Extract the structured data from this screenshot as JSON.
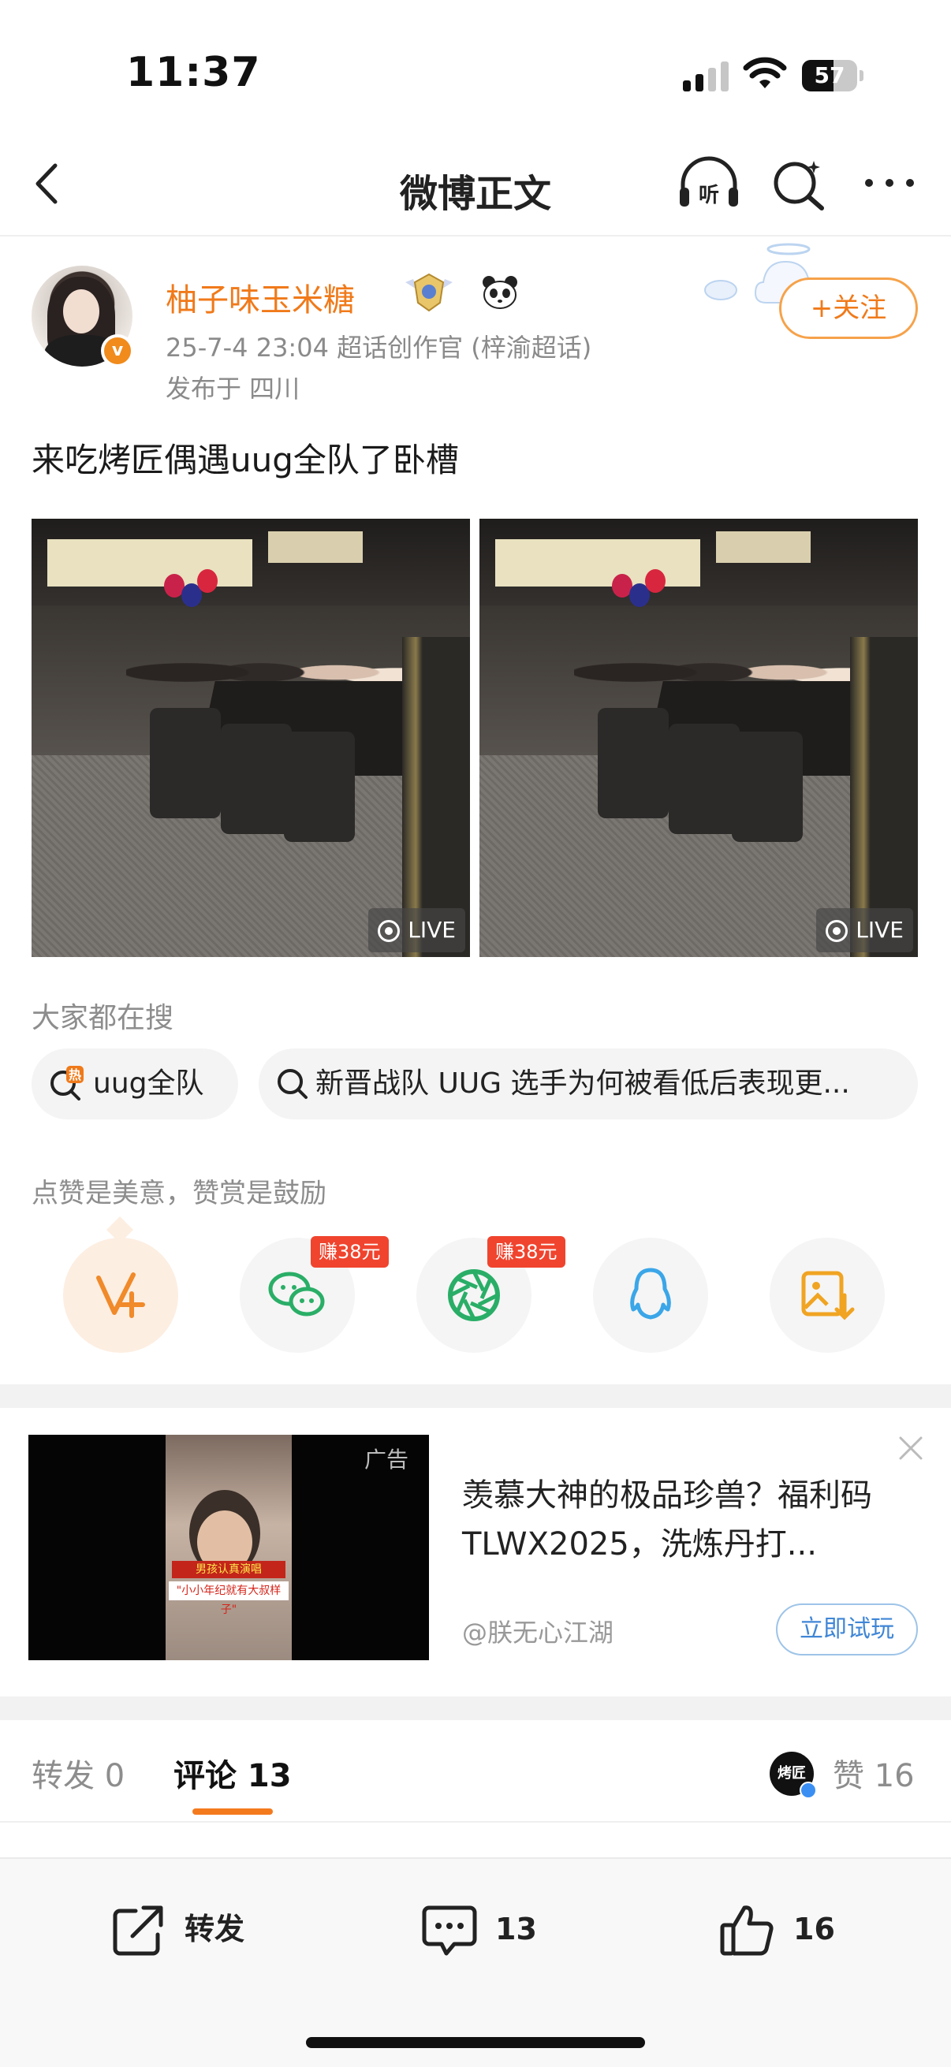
{
  "status_bar": {
    "time": "11:37",
    "battery": "57",
    "battery_level": 0.57
  },
  "nav": {
    "title": "微博正文",
    "listen_icon_text": "听"
  },
  "post": {
    "username": "柚子味玉米糖",
    "meta": "25-7-4 23:04  超话创作官 (梓渝超话)",
    "location": "发布于 四川",
    "follow_label": "+关注",
    "text": "来吃烤匠偶遇uug全队了卧槽",
    "live_label": "LIVE"
  },
  "search": {
    "heading": "大家都在搜",
    "hot_label": "热",
    "pills": [
      "uug全队",
      "新晋战队 UUG 选手为何被看低后表现更..."
    ]
  },
  "share": {
    "heading": "点赞是美意，赞赏是鼓励",
    "badges": [
      "赚38元",
      "赚38元"
    ]
  },
  "ad": {
    "tag": "广告",
    "title": "羡慕大神的极品珍兽？福利码 TLWX2025，洗炼丹打...",
    "source": "@朕无心江湖",
    "button": "立即试玩",
    "caption_1": "男孩认真演唱",
    "caption_2": "\"小小年纪就有大叔样子\""
  },
  "tabs": {
    "repost": "转发 0",
    "comment": "评论 13",
    "like": "赞 16",
    "like_avatar_text": "烤匠"
  },
  "bottom_bar": {
    "repost": "转发",
    "comment": "13",
    "like": "16"
  },
  "colors": {
    "accent": "#f07a1a",
    "earn_red": "#f0442e",
    "link_blue": "#3f86d6"
  }
}
